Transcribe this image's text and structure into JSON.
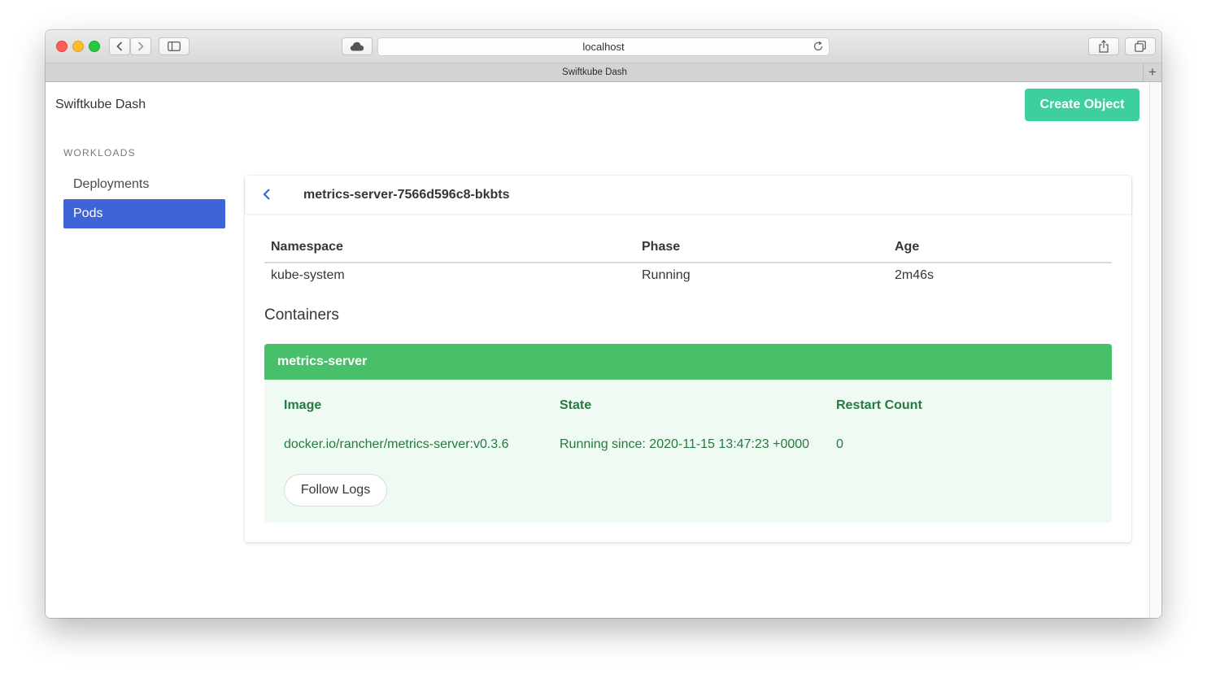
{
  "browser": {
    "url": "localhost",
    "tab_title": "Swiftkube Dash",
    "new_tab_glyph": "+"
  },
  "app": {
    "brand": "Swiftkube Dash",
    "create_button": "Create Object",
    "accent_color": "#3dcfa0",
    "active_color": "#3e64d6"
  },
  "sidebar": {
    "section_label": "WORKLOADS",
    "items": [
      {
        "label": "Deployments",
        "active": false
      },
      {
        "label": "Pods",
        "active": true
      }
    ]
  },
  "pod": {
    "name": "metrics-server-7566d596c8-bkbts",
    "columns": [
      "Namespace",
      "Phase",
      "Age"
    ],
    "values": {
      "namespace": "kube-system",
      "phase": "Running",
      "age": "2m46s"
    }
  },
  "containers": {
    "title": "Containers",
    "items": [
      {
        "name": "metrics-server",
        "header_color": "#48c06a",
        "columns": [
          "Image",
          "State",
          "Restart Count"
        ],
        "image": "docker.io/rancher/metrics-server:v0.3.6",
        "state": "Running since: 2020-11-15 13:47:23 +0000",
        "restart_count": "0",
        "logs_button": "Follow Logs"
      }
    ]
  }
}
